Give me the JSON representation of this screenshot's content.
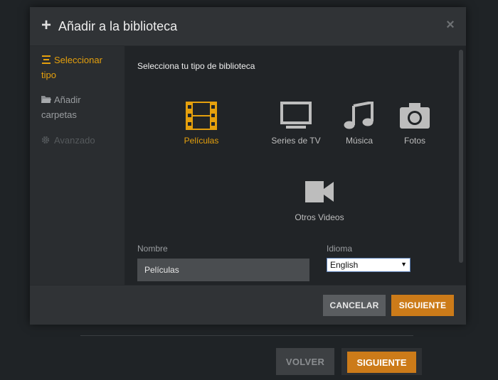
{
  "background": {
    "back_label": "VOLVER",
    "next_label": "SIGUIENTE"
  },
  "modal": {
    "title": "Añadir a la biblioteca",
    "header_icon": "plus-icon",
    "close_icon": "close-icon"
  },
  "sidebar": {
    "items": [
      {
        "label_line1": "Seleccionar",
        "label_line2": "tipo",
        "icon": "list-icon",
        "state": "active"
      },
      {
        "label_line1": "Añadir",
        "label_line2": "carpetas",
        "icon": "folder-icon",
        "state": "normal"
      },
      {
        "label_line1": "Avanzado",
        "icon": "gear-icon",
        "state": "disabled"
      }
    ]
  },
  "content": {
    "section_title": "Selecciona tu tipo de biblioteca",
    "library_types": [
      {
        "label": "Películas",
        "icon": "film-icon",
        "selected": true
      },
      {
        "label": "Series de TV",
        "icon": "tv-icon",
        "selected": false
      },
      {
        "label": "Música",
        "icon": "music-icon",
        "selected": false
      },
      {
        "label": "Fotos",
        "icon": "camera-icon",
        "selected": false
      },
      {
        "label": "Otros Videos",
        "icon": "video-camera-icon",
        "selected": false
      }
    ],
    "name_label": "Nombre",
    "name_value": "Películas",
    "language_label": "Idioma",
    "language_value": "English"
  },
  "footer": {
    "cancel_label": "CANCELAR",
    "next_label": "SIGUIENTE"
  },
  "colors": {
    "accent": "#e5a00d",
    "primary_button": "#cc7b19",
    "panel": "#303336",
    "content_bg": "#212427"
  }
}
